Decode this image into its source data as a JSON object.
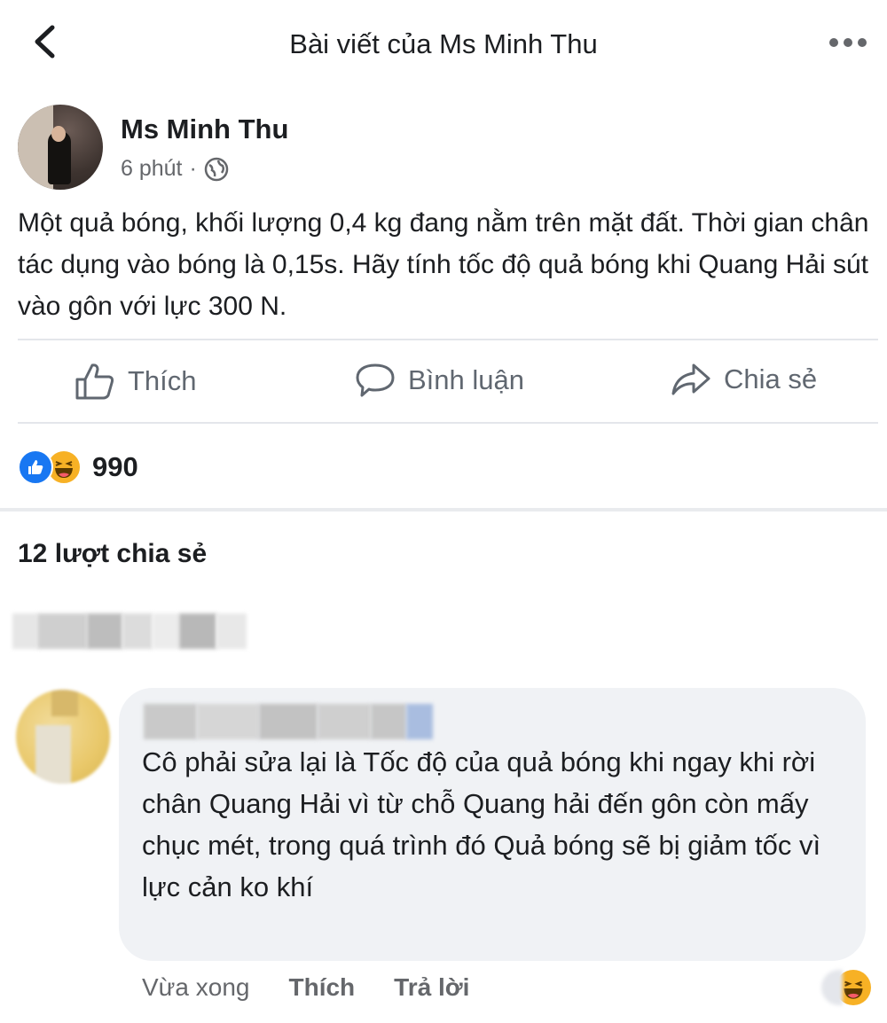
{
  "header": {
    "title": "Bài viết của Ms Minh Thu",
    "back_icon": "chevron-left-icon",
    "more_icon": "more-horizontal-icon"
  },
  "post": {
    "author": "Ms Minh Thu",
    "time": "6 phút",
    "separator": "·",
    "privacy_icon": "globe-icon",
    "text": "Một quả bóng, khối lượng 0,4 kg đang nằm trên mặt đất.  Thời gian chân tác dụng vào bóng là 0,15s. Hãy tính tốc độ quả bóng khi Quang Hải sút vào gôn với lực 300 N."
  },
  "actions": {
    "like": "Thích",
    "comment": "Bình luận",
    "share": "Chia sẻ"
  },
  "reactions": {
    "types": [
      "like",
      "haha"
    ],
    "count": "990",
    "colors": {
      "like": "#1877f2",
      "haha": "#f7b125"
    }
  },
  "shares_text": "12 lượt chia sẻ",
  "comment": {
    "text": "Cô phải sửa lại là Tốc độ của quả bóng khi ngay khi rời chân Quang Hải vì từ chỗ Quang hải đến gôn còn mấy chục mét, trong quá trình đó Quả bóng sẽ bị giảm tốc vì lực cản ko khí",
    "time": "Vừa xong",
    "like": "Thích",
    "reply": "Trả lời"
  },
  "colors": {
    "text": "#1c1e21",
    "secondary": "#65676b",
    "bubble": "#f0f2f5",
    "divider": "#e4e6eb"
  }
}
